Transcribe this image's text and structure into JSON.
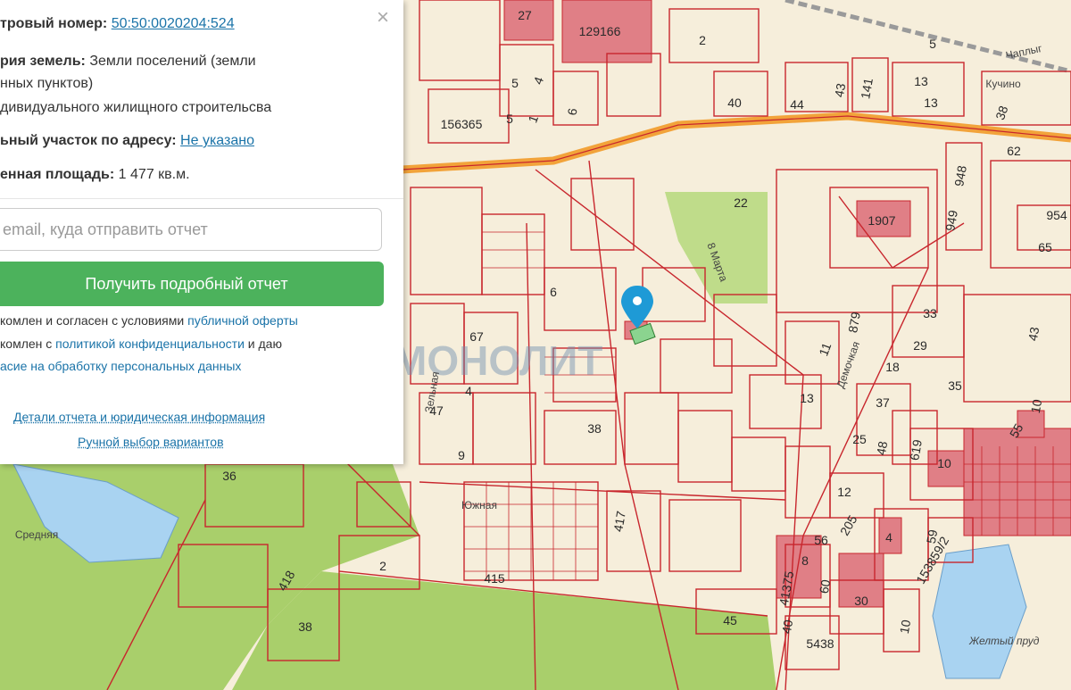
{
  "panel": {
    "cadastral_label": "тровый номер:",
    "cadastral_value": "50:50:0020204:524",
    "category_label": "рия земель:",
    "category_value": "Земли поселений (земли",
    "category_line2": "нных пунктов)",
    "use_line": "дивидуального жилищного строительсва",
    "address_label": "ьный участок по адресу:",
    "address_value": "Не указано",
    "area_label": "енная площадь:",
    "area_value": "1 477 кв.м.",
    "email_placeholder": "email, куда отправить отчет",
    "report_button": "Получить подробный отчет",
    "consent1_text": "комлен и согласен с условиями ",
    "consent1_link": "публичной оферты",
    "consent2_text": "комлен с ",
    "consent2_link": "политикой конфиденциальности",
    "consent2_tail": " и даю",
    "consent3_link": "асие на обработку персональных данных",
    "details_link": "Детали отчета и юридическая информация",
    "manual_link": "Ручной выбор вариантов",
    "close_glyph": "×"
  },
  "map": {
    "watermark": "МОНОЛИТ",
    "parcel_labels": [
      "27",
      "129166",
      "2",
      "5",
      "Чаплыг",
      "5",
      "4",
      "5",
      "1",
      "156365",
      "6",
      "40",
      "44",
      "43",
      "141",
      "13",
      "Кучино",
      "13",
      "38",
      "948",
      "62",
      "22",
      "1907",
      "949",
      "954",
      "65",
      "8 Марта",
      "879",
      "33",
      "43",
      "67",
      "6",
      "11",
      "29",
      "18",
      "35",
      "4",
      "47",
      "38",
      "13",
      "37",
      "619",
      "55",
      "10",
      "9",
      "25",
      "48",
      "10",
      "36",
      "12",
      "205",
      "59",
      "417",
      "4",
      "8",
      "56",
      "2",
      "418",
      "415",
      "60",
      "41375",
      "30",
      "153859/2",
      "38",
      "45",
      "40",
      "5438",
      "10",
      "Желтый пруд",
      "Южная",
      "Средняя",
      "Демочкая",
      "Зельная"
    ],
    "colors": {
      "parcel_line": "#c8262d",
      "building_fill": "#e07f86",
      "land_fill": "#f6eedb",
      "green": "#a9cf6b",
      "water": "#a9d3f1",
      "road": "#f2a33a",
      "pin": "#1e9ad6"
    },
    "icons": [
      "location-pin-icon",
      "close-icon"
    ]
  }
}
